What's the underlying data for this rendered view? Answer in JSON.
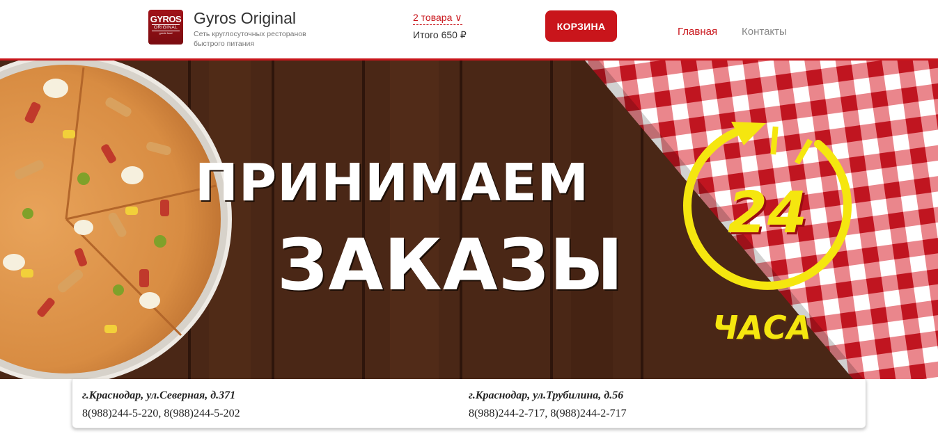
{
  "header": {
    "logo": {
      "line1": "GYROS",
      "line2": "ORIGINAL",
      "line3": "greek food"
    },
    "brand_name": "Gyros Original",
    "brand_subtitle": "Сеть круглосуточных ресторанов быстрого питания",
    "cart": {
      "count_label": "2 товара ∨",
      "total_label": "Итого 650 ₽",
      "button_label": "КОРЗИНА"
    },
    "nav": [
      {
        "label": "Главная",
        "active": true
      },
      {
        "label": "Контакты",
        "active": false
      }
    ]
  },
  "banner": {
    "headline_line1": "ПРИНИМАЕМ",
    "headline_line2": "ЗАКАЗЫ",
    "badge_number": "24",
    "badge_unit": "ЧАСА"
  },
  "addresses": [
    {
      "title": "г.Краснодар, ул.Северная, д.371",
      "phones": "8(988)244-5-220, 8(988)244-5-202"
    },
    {
      "title": "г.Краснодар, ул.Трубилина, д.56",
      "phones": "8(988)244-2-717, 8(988)244-2-717"
    }
  ],
  "colors": {
    "accent": "#c9151b",
    "badge_yellow": "#f5e60f",
    "wood": "#4a2716",
    "text": "#333333"
  }
}
